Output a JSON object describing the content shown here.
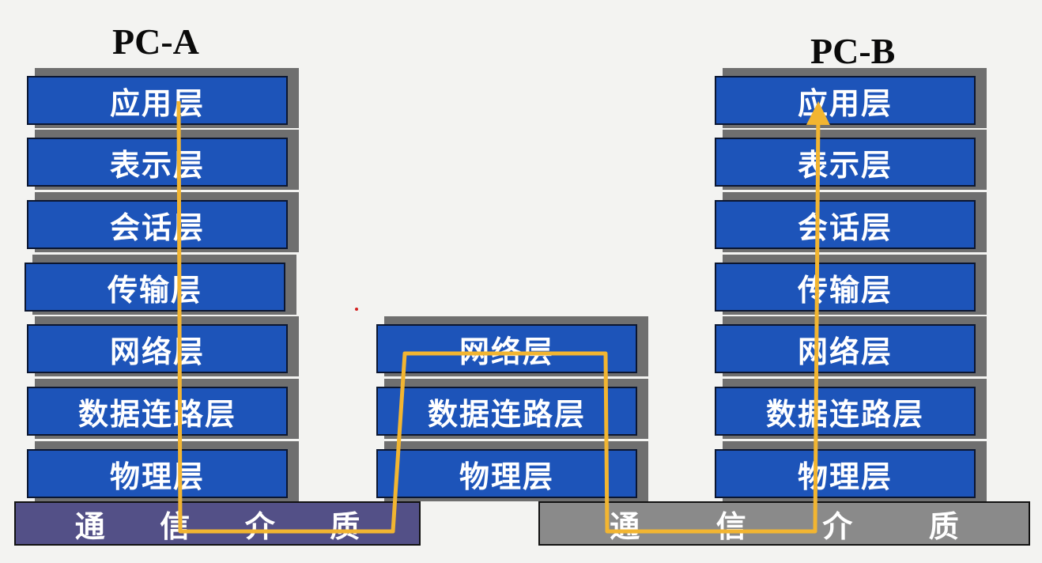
{
  "pc_a": {
    "title": "PC-A",
    "layers": [
      "应用层",
      "表示层",
      "会话层",
      "传输层",
      "网络层",
      "数据连路层",
      "物理层"
    ]
  },
  "router": {
    "layers": [
      "网络层",
      "数据连路层",
      "物理层"
    ]
  },
  "pc_b": {
    "title": "PC-B",
    "layers": [
      "应用层",
      "表示层",
      "会话层",
      "传输层",
      "网络层",
      "数据连路层",
      "物理层"
    ]
  },
  "medium_left": {
    "chars": [
      "通",
      "信",
      "介",
      "质"
    ],
    "color": "#535087"
  },
  "medium_right": {
    "chars": [
      "通",
      "信",
      "介",
      "质"
    ],
    "color": "#8a8a8a"
  },
  "colors": {
    "layer_fill": "#1d54b9",
    "layer_shadow": "#6f6f6f",
    "path": "#f2b531"
  }
}
